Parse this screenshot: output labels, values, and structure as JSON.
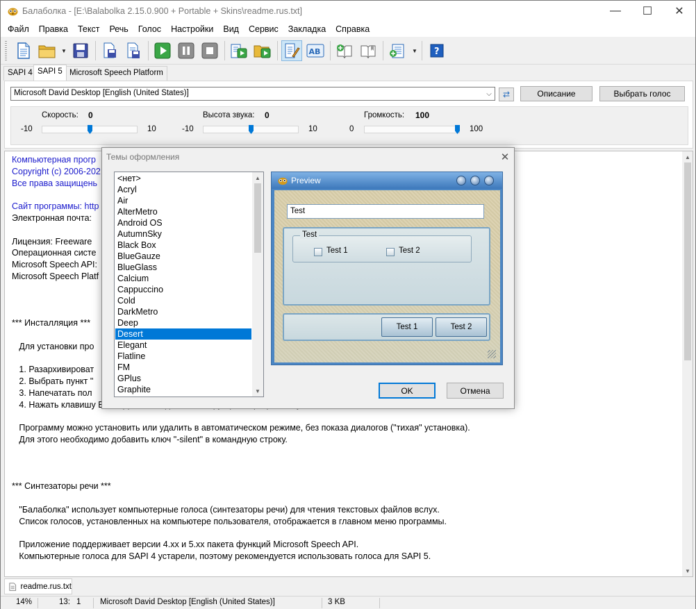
{
  "window": {
    "title": "Балаболка - [E:\\Balabolka 2.15.0.900 + Portable + Skins\\readme.rus.txt]",
    "controls": {
      "minimize": "—",
      "maximize": "☐",
      "close": "✕"
    }
  },
  "menu": [
    "Файл",
    "Правка",
    "Текст",
    "Речь",
    "Голос",
    "Настройки",
    "Вид",
    "Сервис",
    "Закладка",
    "Справка"
  ],
  "toolbar": {
    "icons": [
      "new-document-icon",
      "open-folder-icon",
      "save-icon",
      "save-audio-icon",
      "convert-file-icon",
      "play-icon",
      "pause-icon",
      "stop-icon",
      "read-clipboard-icon",
      "batch-convert-icon",
      "text-edit-icon",
      "spell-check-icon",
      "add-bookmark-icon",
      "bookmarks-icon",
      "dictionary-icon",
      "help-icon"
    ]
  },
  "api_tabs": [
    "SAPI 4",
    "SAPI 5",
    "Microsoft Speech Platform"
  ],
  "voice": {
    "selected": "Microsoft David Desktop [English (United States)]",
    "description_button": "Описание",
    "choose_button": "Выбрать голос"
  },
  "sliders": [
    {
      "label": "Скорость:",
      "value": "0",
      "min": "-10",
      "max": "10",
      "fraction": 0.5
    },
    {
      "label": "Высота звука:",
      "value": "0",
      "min": "-10",
      "max": "10",
      "fraction": 0.5
    },
    {
      "label": "Громкость:",
      "value": "100",
      "min": "0",
      "max": "100",
      "fraction": 1.0
    }
  ],
  "document": {
    "lines": [
      {
        "text": "Компьютерная прогр",
        "color": "blue"
      },
      {
        "text": "Copyright (c) 2006-202",
        "color": "blue"
      },
      {
        "text": "Все права защищень",
        "color": "blue"
      },
      {
        "text": "",
        "color": ""
      },
      {
        "text": "Сайт программы: http",
        "color": "blue"
      },
      {
        "text": "Электронная почта:",
        "color": ""
      },
      {
        "text": "",
        "color": ""
      },
      {
        "text": "Лицензия: Freeware",
        "color": ""
      },
      {
        "text": "Операционная систе",
        "color": ""
      },
      {
        "text": "Microsoft Speech API:",
        "color": ""
      },
      {
        "text": "Microsoft Speech Platf",
        "color": ""
      },
      {
        "text": "",
        "color": ""
      },
      {
        "text": "",
        "color": ""
      },
      {
        "text": "",
        "color": ""
      },
      {
        "text": "*** Инсталляция ***",
        "color": ""
      },
      {
        "text": "",
        "color": ""
      },
      {
        "text": "   Для установки про",
        "color": ""
      },
      {
        "text": "",
        "color": ""
      },
      {
        "text": "   1. Разархивироват",
        "color": ""
      },
      {
        "text": "   2. Выбрать пункт \"",
        "color": ""
      },
      {
        "text": "   3. Напечатать пол",
        "color": ""
      },
      {
        "text": "   4. Нажать клавишу Enter. Далее следовать инструкциям программы установки.",
        "color": ""
      },
      {
        "text": "",
        "color": ""
      },
      {
        "text": "   Программу можно установить или удалить в автоматическом режиме, без показа диалогов (\"тихая\" установка).",
        "color": ""
      },
      {
        "text": "   Для этого необходимо добавить ключ \"-silent\" в командную строку.",
        "color": ""
      },
      {
        "text": "",
        "color": ""
      },
      {
        "text": "",
        "color": ""
      },
      {
        "text": "",
        "color": ""
      },
      {
        "text": "*** Синтезаторы речи ***",
        "color": ""
      },
      {
        "text": "",
        "color": ""
      },
      {
        "text": "   \"Балаболка\" использует компьютерные голоса (синтезаторы речи) для чтения текстовых файлов вслух.",
        "color": ""
      },
      {
        "text": "   Список голосов, установленных на компьютере пользователя, отображается в главном меню программы.",
        "color": ""
      },
      {
        "text": "",
        "color": ""
      },
      {
        "text": "   Приложение поддерживает версии 4.xx и 5.xx пакета функций Microsoft Speech API.",
        "color": ""
      },
      {
        "text": "   Компьютерные голоса для SAPI 4 устарели, поэтому рекомендуется использовать голоса для SAPI 5.",
        "color": ""
      }
    ]
  },
  "doc_tab": "readme.rus.txt",
  "status": {
    "zoom": "14%",
    "line": "13:",
    "col": "1",
    "voice": "Microsoft David Desktop [English (United States)]",
    "size": "3 KB"
  },
  "dialog": {
    "title": "Темы оформления",
    "skins": [
      "<нет>",
      "Acryl",
      "Air",
      "AlterMetro",
      "Android OS",
      "AutumnSky",
      "Black Box",
      "BlueGauze",
      "BlueGlass",
      "Calcium",
      "Cappuccino",
      "Cold",
      "DarkMetro",
      "Deep",
      "Desert",
      "Elegant",
      "Flatline",
      "FM",
      "GPlus",
      "Graphite"
    ],
    "selected_index": 14,
    "preview": {
      "title": "Preview",
      "input": "Test",
      "group": "Test",
      "check1": "Test 1",
      "check2": "Test 2",
      "button1": "Test 1",
      "button2": "Test 2"
    },
    "ok": "OK",
    "cancel": "Отмена"
  }
}
